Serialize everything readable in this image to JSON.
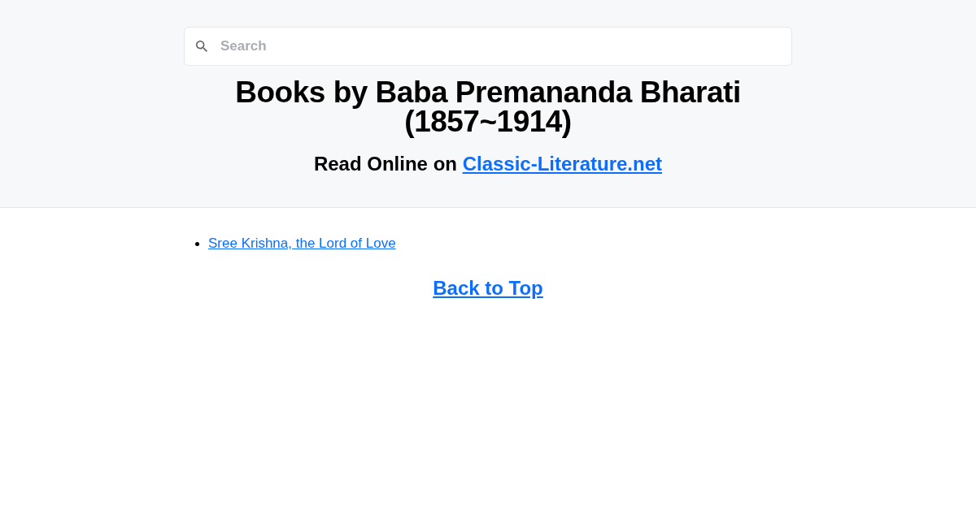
{
  "search": {
    "placeholder": "Search"
  },
  "header": {
    "title": "Books by Baba Premananda Bharati (1857~1914)",
    "subtitle": {
      "text": "Read Online on",
      "link": "Classic-Literature.net"
    }
  },
  "books": [
    {
      "title": "Sree Krishna, the Lord of Love"
    }
  ],
  "back_to_top": "Back to Top"
}
